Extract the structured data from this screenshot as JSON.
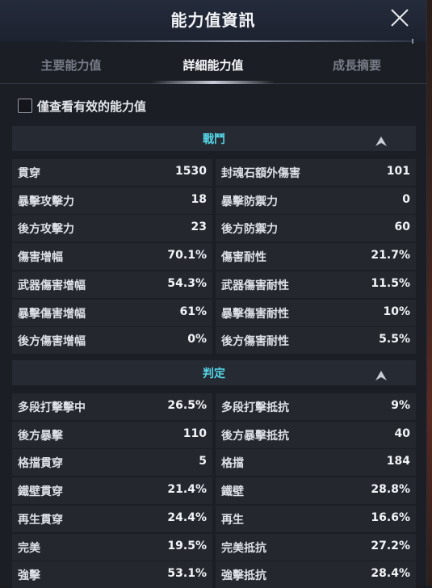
{
  "window": {
    "title": "能力值資訊"
  },
  "tabs": [
    "主要能力值",
    "詳細能力值",
    "成長摘要"
  ],
  "active_tab": "詳細能力值",
  "filter": {
    "label": "僅查看有效的能力值",
    "checked": false
  },
  "colors": {
    "section_title": "#55d6e8",
    "panel_bg": "#1b1e24",
    "cell_bg": "#24272e",
    "header_bg": "#262a33"
  },
  "sections": [
    {
      "title": "戰鬥",
      "rows": [
        {
          "left": {
            "name": "貫穿",
            "value": "1530"
          },
          "right": {
            "name": "封魂石額外傷害",
            "value": "101"
          }
        },
        {
          "left": {
            "name": "暴擊攻擊力",
            "value": "18"
          },
          "right": {
            "name": "暴擊防禦力",
            "value": "0"
          }
        },
        {
          "left": {
            "name": "後方攻擊力",
            "value": "23"
          },
          "right": {
            "name": "後方防禦力",
            "value": "60"
          }
        },
        {
          "left": {
            "name": "傷害增幅",
            "value": "70.1%"
          },
          "right": {
            "name": "傷害耐性",
            "value": "21.7%"
          }
        },
        {
          "left": {
            "name": "武器傷害增幅",
            "value": "54.3%"
          },
          "right": {
            "name": "武器傷害耐性",
            "value": "11.5%"
          }
        },
        {
          "left": {
            "name": "暴擊傷害增幅",
            "value": "61%"
          },
          "right": {
            "name": "暴擊傷害耐性",
            "value": "10%"
          }
        },
        {
          "left": {
            "name": "後方傷害增幅",
            "value": "0%"
          },
          "right": {
            "name": "後方傷害耐性",
            "value": "5.5%"
          }
        }
      ]
    },
    {
      "title": "判定",
      "rows": [
        {
          "left": {
            "name": "多段打擊擊中",
            "value": "26.5%"
          },
          "right": {
            "name": "多段打擊抵抗",
            "value": "9%"
          }
        },
        {
          "left": {
            "name": "後方暴擊",
            "value": "110"
          },
          "right": {
            "name": "後方暴擊抵抗",
            "value": "40"
          }
        },
        {
          "left": {
            "name": "格擋貫穿",
            "value": "5"
          },
          "right": {
            "name": "格擋",
            "value": "184"
          }
        },
        {
          "left": {
            "name": "鐵壁貫穿",
            "value": "21.4%"
          },
          "right": {
            "name": "鐵壁",
            "value": "28.8%"
          }
        },
        {
          "left": {
            "name": "再生貫穿",
            "value": "24.4%"
          },
          "right": {
            "name": "再生",
            "value": "16.6%"
          }
        },
        {
          "left": {
            "name": "完美",
            "value": "19.5%"
          },
          "right": {
            "name": "完美抵抗",
            "value": "27.2%"
          }
        },
        {
          "left": {
            "name": "強擊",
            "value": "53.1%"
          },
          "right": {
            "name": "強擊抵抗",
            "value": "28.4%"
          }
        }
      ]
    }
  ]
}
